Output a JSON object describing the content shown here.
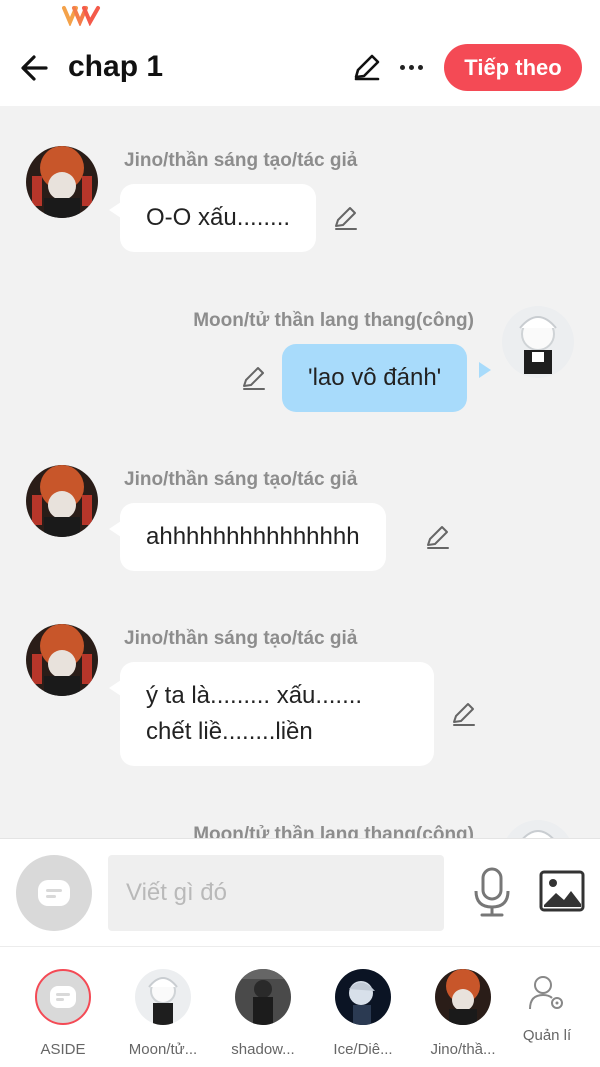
{
  "header": {
    "title": "chap 1",
    "next_label": "Tiếp theo"
  },
  "messages": [
    {
      "sender": "Jino/thần sáng tạo/tác giả",
      "text": "O-O xấu........",
      "side": "left"
    },
    {
      "sender": "Moon/tử thần lang thang(công)",
      "text": "'lao vô đánh'",
      "side": "right"
    },
    {
      "sender": "Jino/thần sáng tạo/tác giả",
      "text": "ahhhhhhhhhhhhhhh",
      "side": "left"
    },
    {
      "sender": "Jino/thần sáng tạo/tác giả",
      "line1": "ý ta là......... xấu.......",
      "line2": "chết liề........liền",
      "side": "left"
    },
    {
      "sender": "Moon/tử thần lang thang(công)",
      "side": "right"
    }
  ],
  "composer": {
    "placeholder": "Viết gì đó"
  },
  "bottombar": {
    "items": [
      {
        "label": "ASIDE"
      },
      {
        "label": "Moon/tử..."
      },
      {
        "label": "shadow..."
      },
      {
        "label": "Ice/Diê..."
      },
      {
        "label": "Jino/thầ..."
      },
      {
        "label": "Quản lí"
      }
    ]
  },
  "colors": {
    "accent": "#f44a55",
    "bubble_self": "#a8dbfb",
    "bubble_other": "#ffffff",
    "background": "#f2f2f2"
  },
  "icons": [
    "back-arrow-icon",
    "pencil-icon",
    "more-icon",
    "chat-icon",
    "microphone-icon",
    "image-icon",
    "manage-user-icon"
  ]
}
